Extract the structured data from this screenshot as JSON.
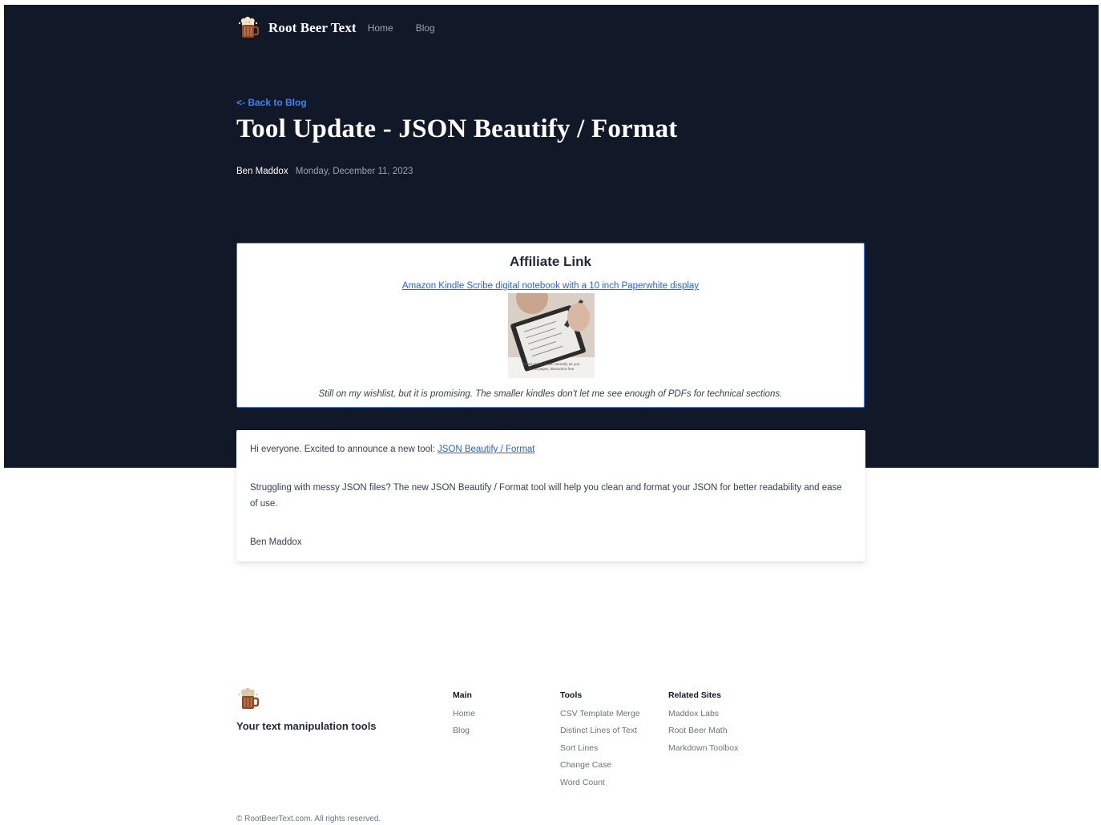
{
  "header": {
    "brand": "Root Beer Text",
    "nav": [
      "Home",
      "Blog"
    ],
    "logo_icon": "root-beer-mug-icon"
  },
  "post": {
    "back_link": "<- Back to Blog",
    "title": "Tool Update - JSON Beautify / Format",
    "author": "Ben Maddox",
    "date": "Monday, December 11, 2023"
  },
  "affiliate": {
    "heading": "Affiliate Link",
    "link_text": "Amazon Kindle Scribe digital notebook with a 10 inch Paperwhite display",
    "image_caption_line1": "Read and write as naturally as you",
    "image_caption_line2": "do on paper, distraction free",
    "note": "Still on my wishlist, but it is promising. The smaller kindles don't let me see enough of PDFs for technical sections."
  },
  "content": {
    "intro": "Hi everyone. Excited to announce a new tool: ",
    "tool_link": "JSON Beautify / Format",
    "body": "Struggling with messy JSON files? The new JSON Beautify / Format tool will help you clean and format your JSON for better readability and ease of use.",
    "signature": "Ben Maddox"
  },
  "footer": {
    "tagline": "Your text manipulation tools",
    "columns": [
      {
        "heading": "Main",
        "links": [
          "Home",
          "Blog"
        ]
      },
      {
        "heading": "Tools",
        "links": [
          "CSV Template Merge",
          "Distinct Lines of Text",
          "Sort Lines",
          "Change Case",
          "Word Count"
        ]
      },
      {
        "heading": "Related Sites",
        "links": [
          "Maddox Labs",
          "Root Beer Math",
          "Markdown Toolbox"
        ]
      }
    ],
    "copyright": "© RootBeerText.com. All rights reserved."
  },
  "colors": {
    "hero_bg": "#111827",
    "accent_blue": "#3b82f6",
    "link_blue": "#2563eb"
  }
}
